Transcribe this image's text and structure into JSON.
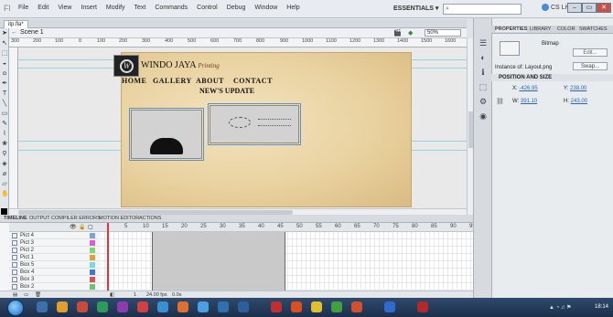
{
  "menubar": {
    "items": [
      "File",
      "Edit",
      "View",
      "Insert",
      "Modify",
      "Text",
      "Commands",
      "Control",
      "Debug",
      "Window",
      "Help"
    ],
    "workspace": "ESSENTIALS ▾",
    "cs_live": "CS Live"
  },
  "document": {
    "tab": "itp.fla*"
  },
  "scenebar": {
    "scene": "Scene 1",
    "zoom": "50%"
  },
  "ruler": {
    "ticks": [
      "300",
      "200",
      "100",
      "0",
      "100",
      "200",
      "300",
      "400",
      "500",
      "600",
      "700",
      "800",
      "900",
      "1000",
      "1100",
      "1200",
      "1300",
      "1400",
      "1500",
      "1600"
    ]
  },
  "stage": {
    "brand_name": "WINDO JAYA",
    "brand_tagline": "Printing",
    "logo_letter": "W",
    "nav": [
      "HOME",
      "GALLERY",
      "ABOUT",
      "CONTACT"
    ],
    "nav_update": "NEW'S UPDATE"
  },
  "timeline": {
    "tabs": [
      "TIMELINE",
      "OUTPUT",
      "COMPILER ERRORS",
      "MOTION EDITOR",
      "ACTIONS"
    ],
    "frame_numbers": [
      "5",
      "10",
      "15",
      "20",
      "25",
      "30",
      "35",
      "40",
      "45",
      "50",
      "55",
      "60",
      "65",
      "70",
      "75",
      "80",
      "85",
      "90",
      "95"
    ],
    "layers": [
      {
        "name": "Pict 4",
        "color": "#7aa5d8"
      },
      {
        "name": "Pict 3",
        "color": "#e05ad0"
      },
      {
        "name": "Pict 2",
        "color": "#7adb6b"
      },
      {
        "name": "Pict 1",
        "color": "#e0a040"
      },
      {
        "name": "Box 5",
        "color": "#7ad9e0"
      },
      {
        "name": "Box 4",
        "color": "#3a7bd0"
      },
      {
        "name": "Box 3",
        "color": "#e05050"
      },
      {
        "name": "Box 2",
        "color": "#70c070"
      },
      {
        "name": "Box 1",
        "color": "#d0c040"
      },
      {
        "name": "Layer 1",
        "color": "#999"
      }
    ],
    "footer": {
      "current_frame": "1",
      "fps": "24.00 fps",
      "time": "0.0s"
    }
  },
  "panel": {
    "tabs": [
      "PROPERTIES",
      "LIBRARY",
      "COLOR",
      "SWATCHES"
    ],
    "type_label": "Bitmap",
    "edit_button": "Edit...",
    "instance_label": "Instance of: Layout.png",
    "swap_button": "Swap...",
    "section_title": "POSITION AND SIZE",
    "x_label": "X:",
    "x_value": "-426.95",
    "y_label": "Y:",
    "y_value": "238.00",
    "w_label": "W:",
    "w_value": "391.10",
    "h_label": "H:",
    "h_value": "243.00"
  },
  "taskbar": {
    "time": "18:14"
  },
  "colors": {
    "accent": "#2a64b4",
    "playhead": "#e0353b",
    "guide": "#7fd0e0"
  }
}
